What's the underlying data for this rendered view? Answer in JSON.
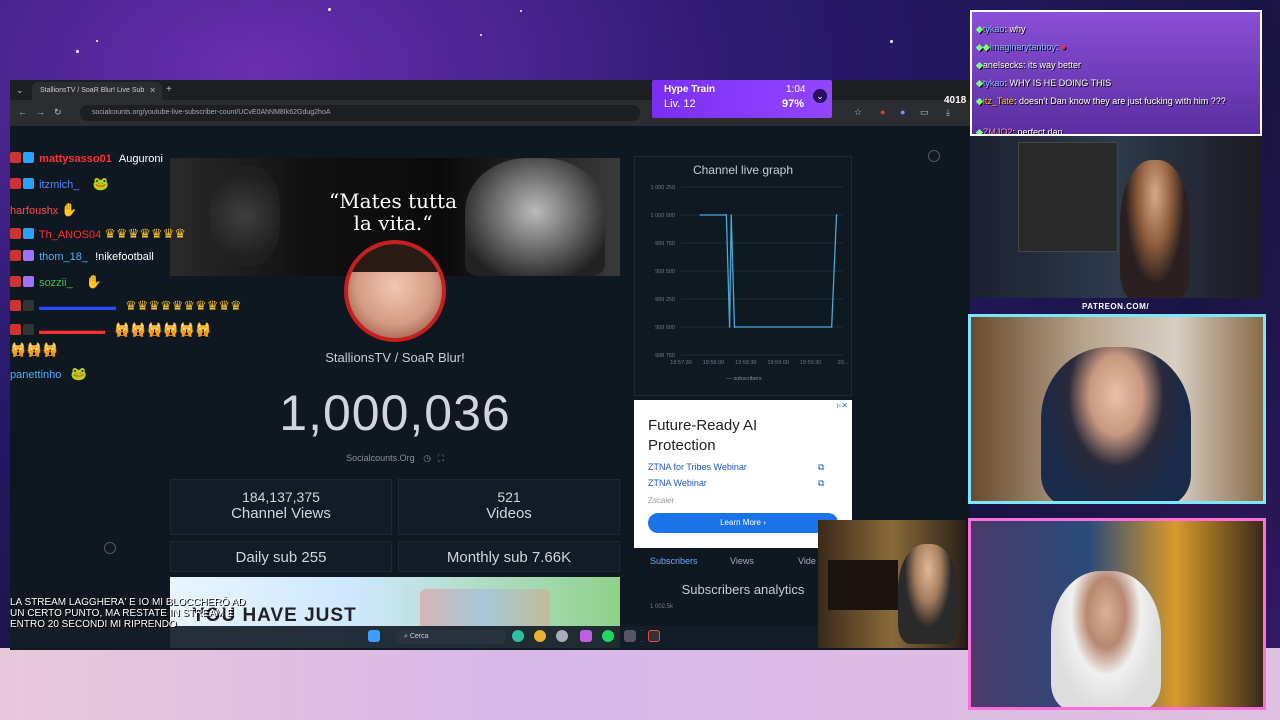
{
  "browser": {
    "tab_title": "StallionsTV / SoaR Blur! Live Sub",
    "url": "socialcounts.org/youtube-live-subscriber-count/UCvE0AhNM8Ik62Gdug2hoA"
  },
  "hype_train": {
    "title": "Hype Train",
    "level": "Liv. 12",
    "time": "1:04",
    "percent": "97%",
    "side_counter": "4018"
  },
  "channel": {
    "banner_quote": "“Mates tutta la vita.“",
    "name": "StallionsTV / SoaR Blur!",
    "subscriber_count": "1,000,036",
    "brand": "Socialcounts.Org"
  },
  "stats": {
    "views_value": "184,137,375",
    "views_label": "Channel Views",
    "videos_value": "521",
    "videos_label": "Videos",
    "daily_sub": "Daily sub 255",
    "monthly_sub": "Monthly sub 7.66K"
  },
  "graph": {
    "title": "Channel live graph",
    "legend": "subscribers",
    "y_ticks": [
      "1 000 250",
      "1 000 000",
      "999 750",
      "999 500",
      "999 250",
      "999 000",
      "998 750"
    ],
    "x_ticks": [
      "19:57:30",
      "19:58:00",
      "19:58:30",
      "19:59:00",
      "19:59:30",
      "20..."
    ]
  },
  "chart_data": {
    "type": "line",
    "title": "Channel live graph",
    "xlabel": "",
    "ylabel": "",
    "x": [
      "19:57:30",
      "19:58:00",
      "19:58:05",
      "19:58:10",
      "19:58:15",
      "19:59:30",
      "19:59:40"
    ],
    "series": [
      {
        "name": "subscribers",
        "values": [
          1000000,
          1000000,
          999000,
          1000000,
          999000,
          999000,
          1000000
        ]
      }
    ],
    "ylim": [
      998750,
      1000250
    ],
    "grid": true,
    "legend": "bottom"
  },
  "ad": {
    "title": "Future-Ready AI Protection",
    "link1": "ZTNA for Tribes Webinar",
    "link2": "ZTNA Webinar",
    "source": "Zscaler",
    "button": "Learn More"
  },
  "analytics": {
    "tabs": [
      "Subscribers",
      "Views",
      "Vide"
    ],
    "title": "Subscribers analytics",
    "tick": "1 002.5k"
  },
  "game_banner": {
    "text": "YOU HAVE JUST"
  },
  "taskbar": {
    "search": "Cerca"
  },
  "left_chat": [
    {
      "user": "mattysasso01",
      "msg": "Auguroni",
      "color": "#ff3030"
    },
    {
      "user": "itzmich_",
      "msg": "",
      "color": "#4a8aff"
    },
    {
      "user": "harfoushx",
      "msg": "",
      "color": "#ff4a4a"
    },
    {
      "user": "Th_ANOS04",
      "msg": "",
      "color": "#ff3030"
    },
    {
      "user": "thom_18_",
      "msg": "!nikefootball",
      "color": "#4ab0ff"
    },
    {
      "user": "sozzii_",
      "msg": "",
      "color": "#3ac04a"
    },
    {
      "user": "panettinho",
      "msg": "",
      "color": "#4ab0ff"
    }
  ],
  "overlay_message": "LA STREAM LAGGHERA' E IO MI BLOCCHERò AD UN CERTO PUNTO, MA RESTATE IN STREAM E ENTRO 20 SECONDI MI RIPRENDO",
  "right_chat": [
    {
      "user": "tykao",
      "msg": "why"
    },
    {
      "user": "imaginarytanboy",
      "msg": ""
    },
    {
      "user": "anelsecks",
      "msg": "its way better"
    },
    {
      "user": "tykao",
      "msg": "WHY IS HE DOING THIS"
    },
    {
      "user": "itz_Tate",
      "msg": "doesn't Dan know they are just fucking with him ???"
    },
    {
      "user": "ZMJO2",
      "msg": "perfect dan"
    }
  ],
  "patreon": "PATREON.COM/"
}
